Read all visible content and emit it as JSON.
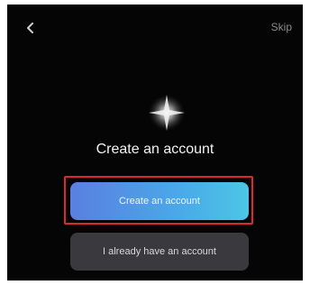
{
  "header": {
    "back_icon": "chevron-left-icon",
    "skip_label": "Skip"
  },
  "main": {
    "logo_icon": "sparkle-logo-icon",
    "title": "Create an account",
    "create_button_label": "Create an account",
    "login_button_label": "I already have an account"
  },
  "colors": {
    "background": "#050505",
    "primary_gradient_start": "#5a7fe0",
    "primary_gradient_end": "#4cc6e6",
    "secondary_button": "#3a3a3e",
    "highlight_border": "#e0262d"
  }
}
